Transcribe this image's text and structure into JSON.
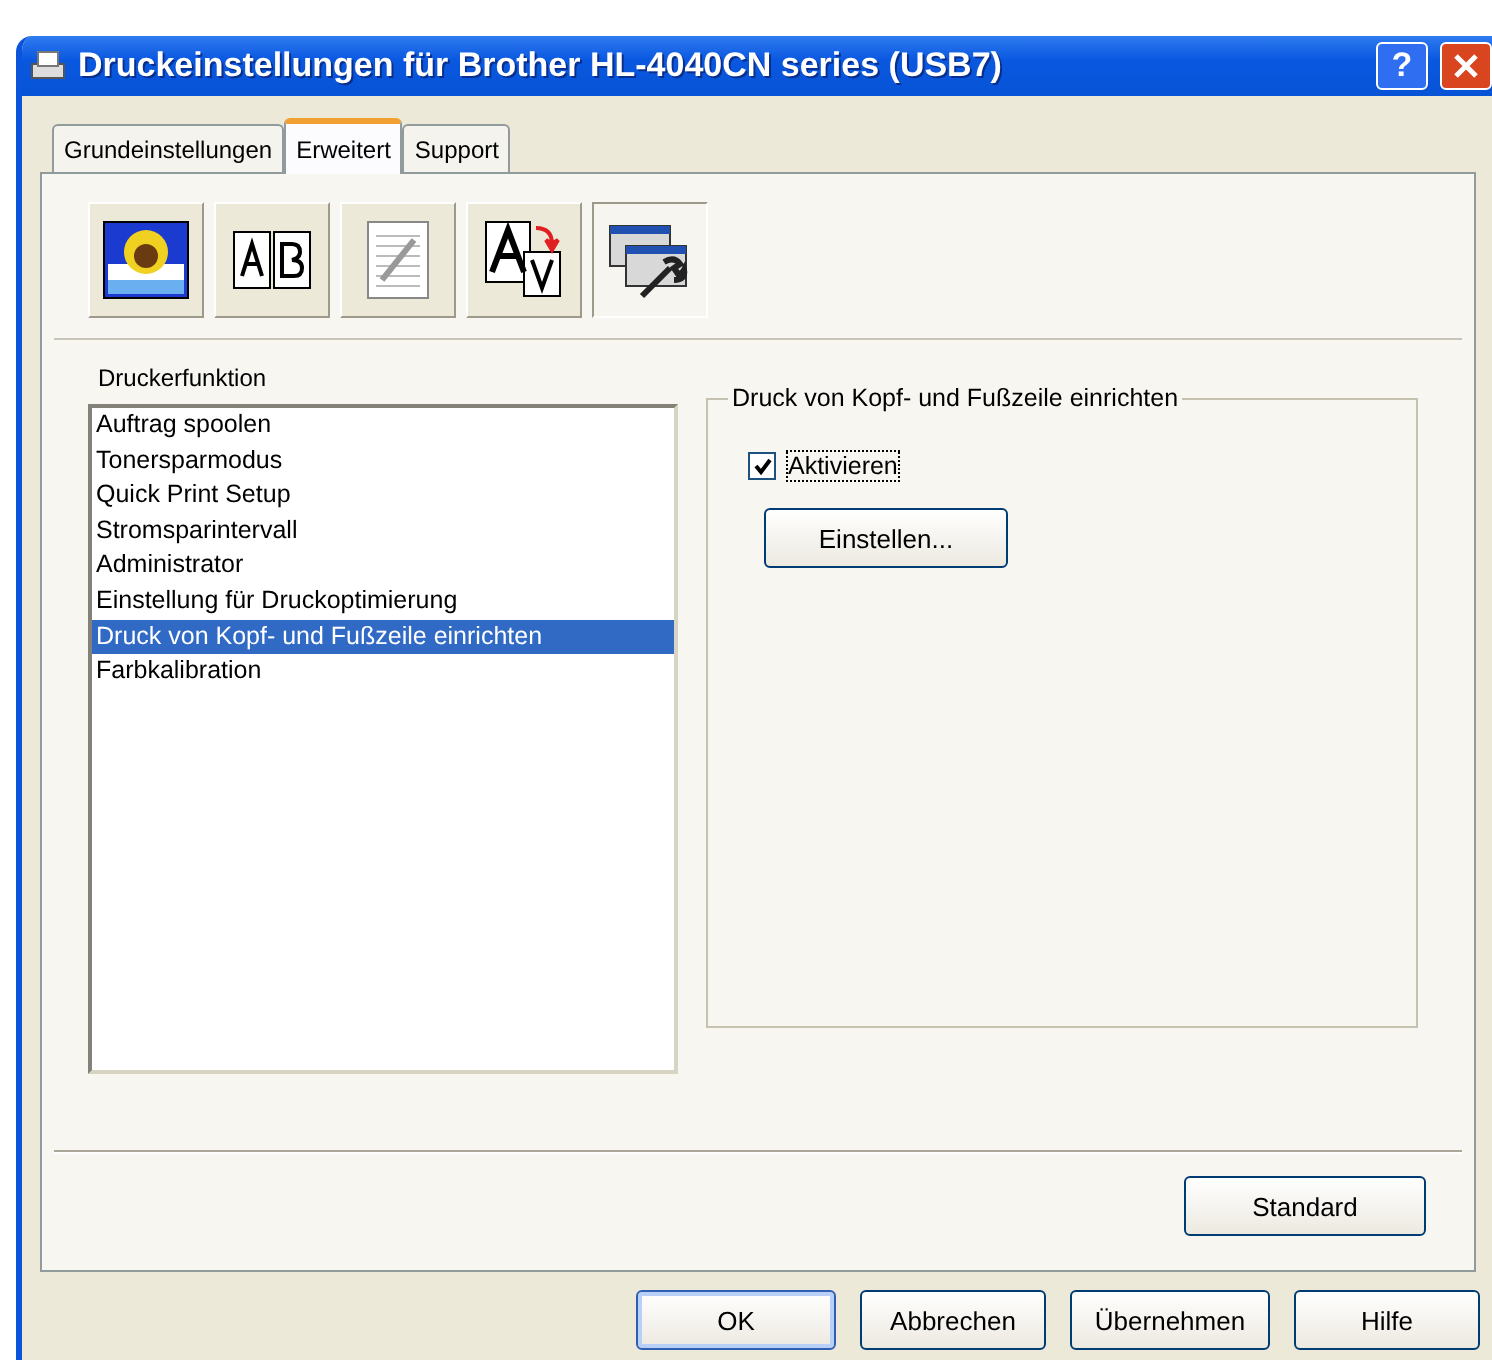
{
  "window": {
    "title": "Druckeinstellungen für Brother HL-4040CN series (USB7)",
    "help_button": "?"
  },
  "tabs": [
    {
      "label": "Grundeinstellungen",
      "selected": false
    },
    {
      "label": "Erweitert",
      "selected": true
    },
    {
      "label": "Support",
      "selected": false
    }
  ],
  "toolbar": [
    {
      "kind": "picture",
      "selected": false
    },
    {
      "kind": "duplex",
      "selected": false
    },
    {
      "kind": "copy",
      "selected": false
    },
    {
      "kind": "font",
      "selected": false
    },
    {
      "kind": "settings",
      "selected": true
    }
  ],
  "function_list": {
    "label": "Druckerfunktion",
    "items": [
      {
        "label": "Auftrag spoolen",
        "selected": false
      },
      {
        "label": "Tonersparmodus",
        "selected": false
      },
      {
        "label": "Quick Print Setup",
        "selected": false
      },
      {
        "label": "Stromsparintervall",
        "selected": false
      },
      {
        "label": "Administrator",
        "selected": false
      },
      {
        "label": "Einstellung für Druckoptimierung",
        "selected": false
      },
      {
        "label": "Druck von Kopf- und Fußzeile einrichten",
        "selected": true
      },
      {
        "label": "Farbkalibration",
        "selected": false
      }
    ]
  },
  "group": {
    "title": "Druck von Kopf- und Fußzeile einrichten",
    "checkbox": {
      "label": "Aktivieren",
      "checked": true
    },
    "button": "Einstellen..."
  },
  "standard_button": "Standard",
  "buttons": [
    {
      "label": "OK",
      "default": true
    },
    {
      "label": "Abbrechen",
      "default": false
    },
    {
      "label": "Übernehmen",
      "default": false
    },
    {
      "label": "Hilfe",
      "default": false
    }
  ]
}
